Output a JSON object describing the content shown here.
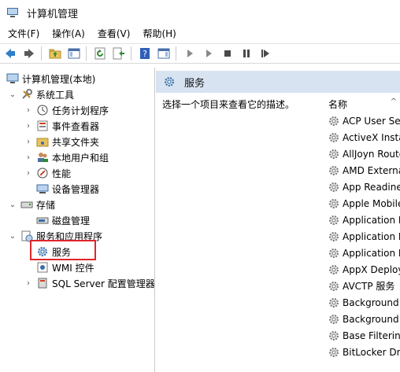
{
  "window": {
    "title": "计算机管理",
    "icon": "computer-management-icon"
  },
  "menu": [
    "文件(F)",
    "操作(A)",
    "查看(V)",
    "帮助(H)"
  ],
  "toolbar": {
    "buttons": [
      "back-arrow-icon",
      "forward-arrow-icon",
      "up-folder-icon",
      "show-hide-tree-icon",
      "refresh-icon",
      "export-list-icon",
      "help-icon",
      "show-hide-action-pane-icon",
      "play-icon",
      "play-alt-icon",
      "stop-icon",
      "pause-icon",
      "restart-icon"
    ]
  },
  "tree": {
    "root": "计算机管理(本地)",
    "system_tools": "系统工具",
    "task_scheduler": "任务计划程序",
    "event_viewer": "事件查看器",
    "shared_folders": "共享文件夹",
    "local_users": "本地用户和组",
    "performance": "性能",
    "device_manager": "设备管理器",
    "storage": "存储",
    "disk_management": "磁盘管理",
    "services_apps": "服务和应用程序",
    "services": "服务",
    "wmi": "WMI 控件",
    "sql_server": "SQL Server 配置管理器"
  },
  "right": {
    "header": "服务",
    "description": "选择一个项目来查看它的描述。",
    "column_name": "名称",
    "services": [
      "ACP User Ser",
      "ActiveX Insta",
      "AllJoyn Route",
      "AMD Externa",
      "App Readine",
      "Apple Mobile",
      "Application Id",
      "Application L",
      "Application M",
      "AppX Deploy",
      "AVCTP 服务",
      "Background",
      "Background",
      "Base Filtering",
      "BitLocker Driv"
    ]
  },
  "colors": {
    "header_bg": "#d8e3f1",
    "selection_outline": "#e0262b"
  }
}
